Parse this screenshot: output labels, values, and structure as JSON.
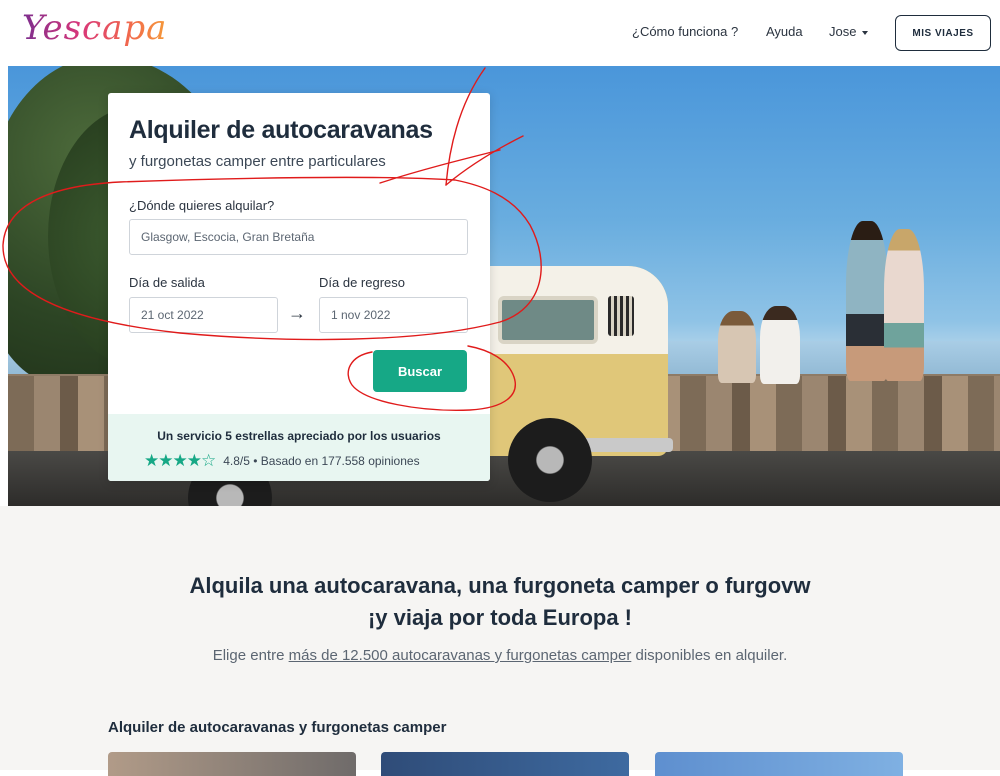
{
  "header": {
    "logo_text": "Yescapa",
    "nav": {
      "how_it_works": "¿Cómo funciona ?",
      "help": "Ayuda",
      "user": "Jose"
    },
    "trips_button": "MIS VIAJES"
  },
  "search_card": {
    "title": "Alquiler de autocaravanas",
    "subtitle": "y furgonetas camper entre particulares",
    "where_label": "¿Dónde quieres alquilar?",
    "where_value": "Glasgow, Escocia, Gran Bretaña",
    "departure_label": "Día de salida",
    "departure_value": "21 oct 2022",
    "return_label": "Día de regreso",
    "return_value": "1 nov 2022",
    "arrow": "→",
    "search_button": "Buscar",
    "rating_title": "Un servicio 5 estrellas apreciado por los usuarios",
    "stars": "★★★★☆",
    "rating_text": "4.8/5 • Basado en 177.558 opiniones"
  },
  "main": {
    "headline_line1": "Alquila una autocaravana, una furgoneta camper o furgovw",
    "headline_line2": "¡y viaja por toda Europa !",
    "desc_before": "Elige entre ",
    "desc_link": "más de 12.500 autocaravanas y furgonetas camper",
    "desc_after": " disponibles en alquiler.",
    "section_title": "Alquiler de autocaravanas y furgonetas camper"
  },
  "colors": {
    "accent": "#16a886",
    "annotation": "#e01b1b"
  }
}
